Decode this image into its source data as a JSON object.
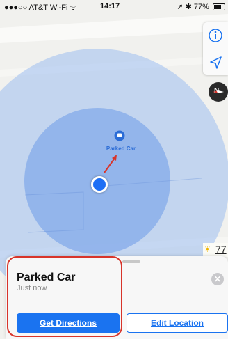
{
  "status_bar": {
    "carrier": "●●●○○ AT&T Wi-Fi ᯤ",
    "time": "14:17",
    "right": "➚ ✱ 77%"
  },
  "map": {
    "car_label": "Parked Car",
    "weather_temp": "77",
    "compass_label": "N",
    "accent_color": "#1a73f0",
    "accuracy_color": "#8fb3f0"
  },
  "controls": {
    "info_icon": "info-icon",
    "location_icon": "location-arrow-icon"
  },
  "card": {
    "title": "Parked Car",
    "subtitle": "Just now",
    "close_label": "✕",
    "primary_button": "Get Directions",
    "secondary_button": "Edit Location"
  }
}
